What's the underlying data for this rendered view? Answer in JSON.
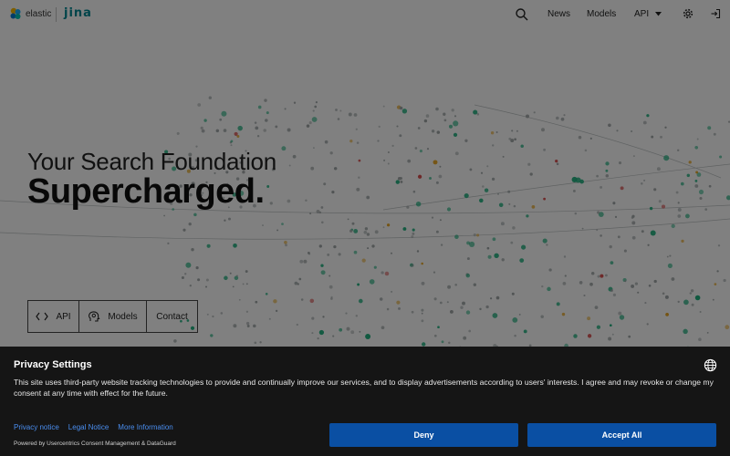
{
  "header": {
    "brand_elastic": "elastic",
    "brand_jina": "jina",
    "nav": [
      {
        "label": "News"
      },
      {
        "label": "Models"
      },
      {
        "label": "API"
      }
    ]
  },
  "hero": {
    "line1": "Your Search Foundation",
    "line2": "Supercharged."
  },
  "cta": [
    {
      "label": "API"
    },
    {
      "label": "Models"
    },
    {
      "label": "Contact"
    }
  ],
  "consent": {
    "title": "Privacy Settings",
    "body": "This site uses third-party website tracking technologies to provide and continually improve our services, and to display advertisements according to users' interests. I agree and may revoke or change my consent at any time with effect for the future.",
    "links": [
      "Privacy notice",
      "Legal Notice",
      "More Information"
    ],
    "powered_by": "Powered by Usercentrics Consent Management & DataGuard",
    "deny_label": "Deny",
    "accept_label": "Accept All"
  },
  "colors": {
    "accent_blue": "#0a4fa3",
    "link_blue": "#4a8ef0",
    "jina_teal": "#00838f",
    "particle_green": "#1faa7a",
    "particle_orange": "#e0a020",
    "particle_red": "#d04040"
  }
}
